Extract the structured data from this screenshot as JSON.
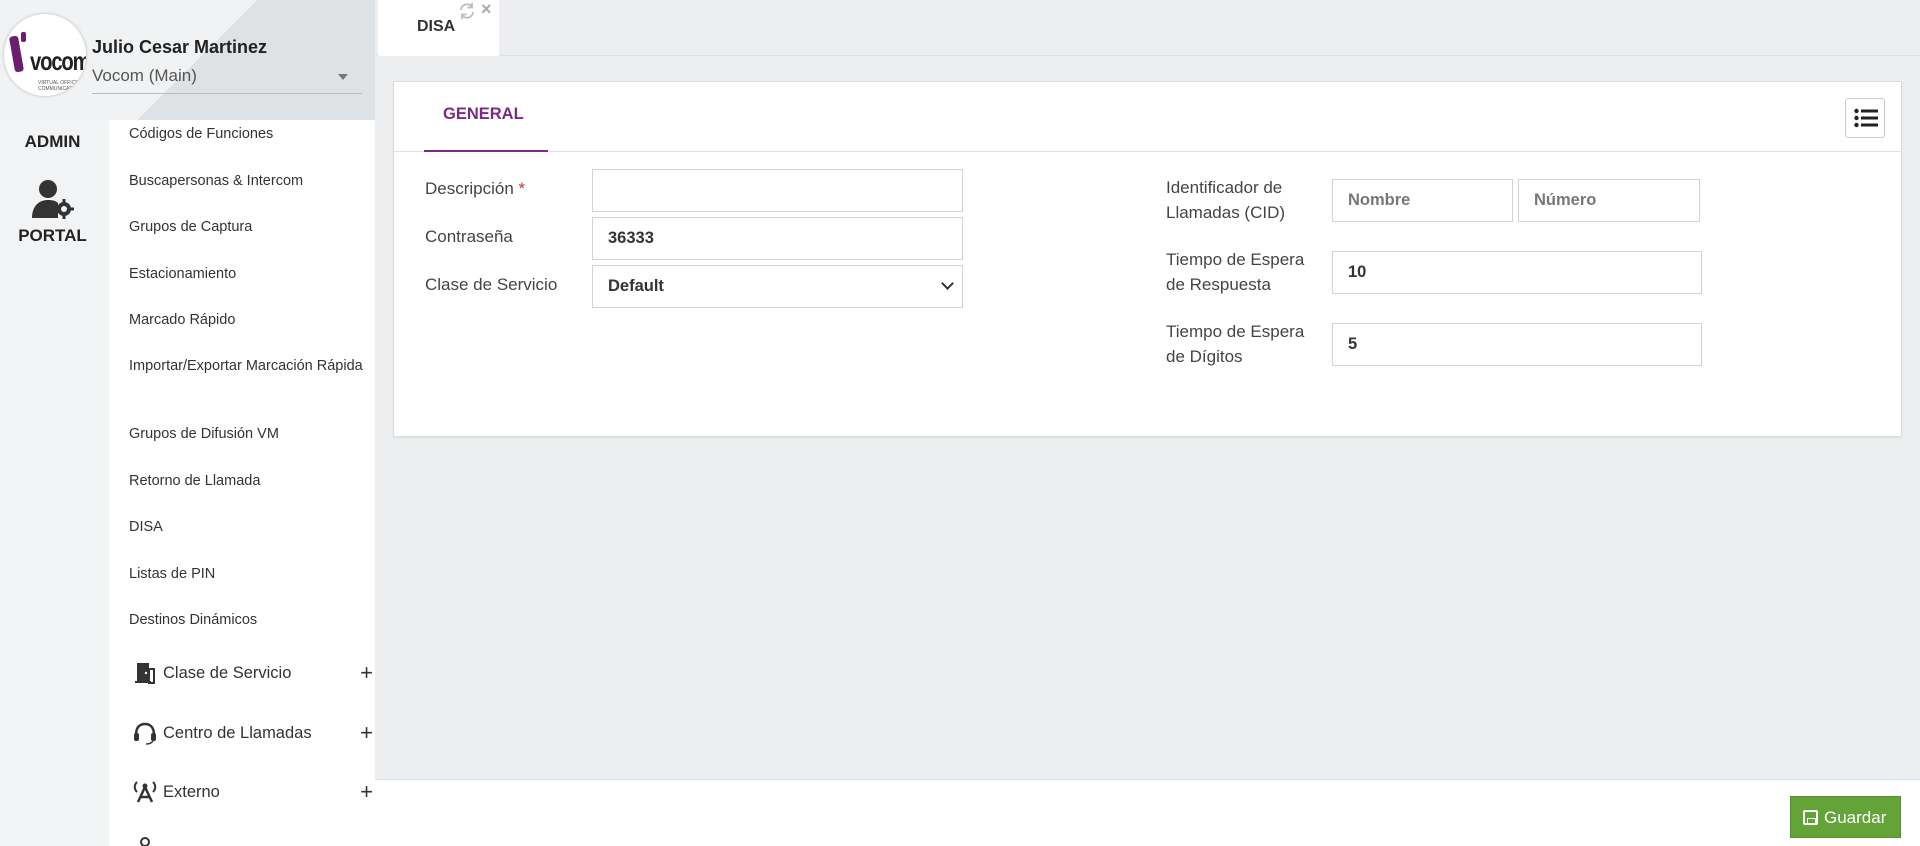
{
  "user": {
    "name": "Julio Cesar Martinez",
    "tenant": "Vocom (Main)"
  },
  "logo": {
    "word": "vocom",
    "sub": "VIRTUAL OFFICE COMMUNICATIONS"
  },
  "rail": {
    "admin": "ADMIN",
    "portal": "PORTAL"
  },
  "menu": {
    "items": [
      "Códigos de Funciones",
      "Buscapersonas & Intercom",
      "Grupos de Captura",
      "Estacionamiento",
      "Marcado Rápido",
      "Importar/Exportar Marcación Rápida",
      "Grupos de Difusión VM",
      "Retorno de Llamada",
      "DISA",
      "Listas de PIN",
      "Destinos Dinámicos"
    ],
    "groups": [
      {
        "label": "Clase de Servicio",
        "icon": "door-icon"
      },
      {
        "label": "Centro de Llamadas",
        "icon": "headset-icon"
      },
      {
        "label": "Externo",
        "icon": "antenna-icon"
      }
    ]
  },
  "tab": {
    "label": "DISA"
  },
  "card": {
    "tab_general": "GENERAL"
  },
  "form": {
    "descripcion": {
      "label": "Descripción",
      "required": "*",
      "value": ""
    },
    "contrasena": {
      "label": "Contraseña",
      "value": "36333"
    },
    "clase": {
      "label": "Clase de Servicio",
      "value": "Default"
    },
    "cid": {
      "label": "Identificador de Llamadas (CID)",
      "nombre_placeholder": "Nombre",
      "numero_placeholder": "Número"
    },
    "espera_respuesta": {
      "label": "Tiempo de Espera de Respuesta",
      "value": "10"
    },
    "espera_digitos": {
      "label": "Tiempo de Espera de Dígitos",
      "value": "5"
    }
  },
  "actions": {
    "save": "Guardar"
  },
  "colors": {
    "accent": "#7b2a86",
    "save": "#64a338"
  }
}
